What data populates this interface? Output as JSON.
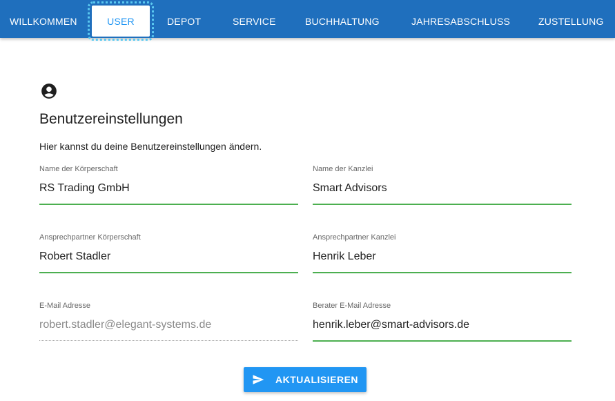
{
  "nav": {
    "tabs": [
      {
        "label": "WILLKOMMEN"
      },
      {
        "label": "USER",
        "active": true
      },
      {
        "label": "DEPOT"
      },
      {
        "label": "SERVICE"
      },
      {
        "label": "BUCHHALTUNG"
      },
      {
        "label": "JAHRESABSCHLUSS"
      },
      {
        "label": "ZUSTELLUNG"
      }
    ]
  },
  "header": {
    "icon": "account-circle-icon",
    "title": "Benutzereinstellungen",
    "description": "Hier kannst du deine Benutzereinstellungen ändern."
  },
  "form": {
    "koerperschaft_name": {
      "label": "Name der Körperschaft",
      "value": "RS Trading GmbH"
    },
    "kanzlei_name": {
      "label": "Name der Kanzlei",
      "value": "Smart Advisors"
    },
    "koerperschaft_contact": {
      "label": "Ansprechpartner Körperschaft",
      "value": "Robert Stadler"
    },
    "kanzlei_contact": {
      "label": "Ansprechpartner Kanzlei",
      "value": "Henrik Leber"
    },
    "email": {
      "label": "E-Mail Adresse",
      "value": "robert.stadler@elegant-systems.de",
      "disabled": true
    },
    "advisor_email": {
      "label": "Berater E-Mail Adresse",
      "value": "henrik.leber@smart-advisors.de"
    }
  },
  "submit": {
    "label": "AKTUALISIEREN",
    "icon": "send-icon"
  },
  "colors": {
    "nav_bg": "#1f6fbd",
    "primary": "#2196f3",
    "field_underline": "#4caf50",
    "focus_outline": "#5ac8f0"
  }
}
